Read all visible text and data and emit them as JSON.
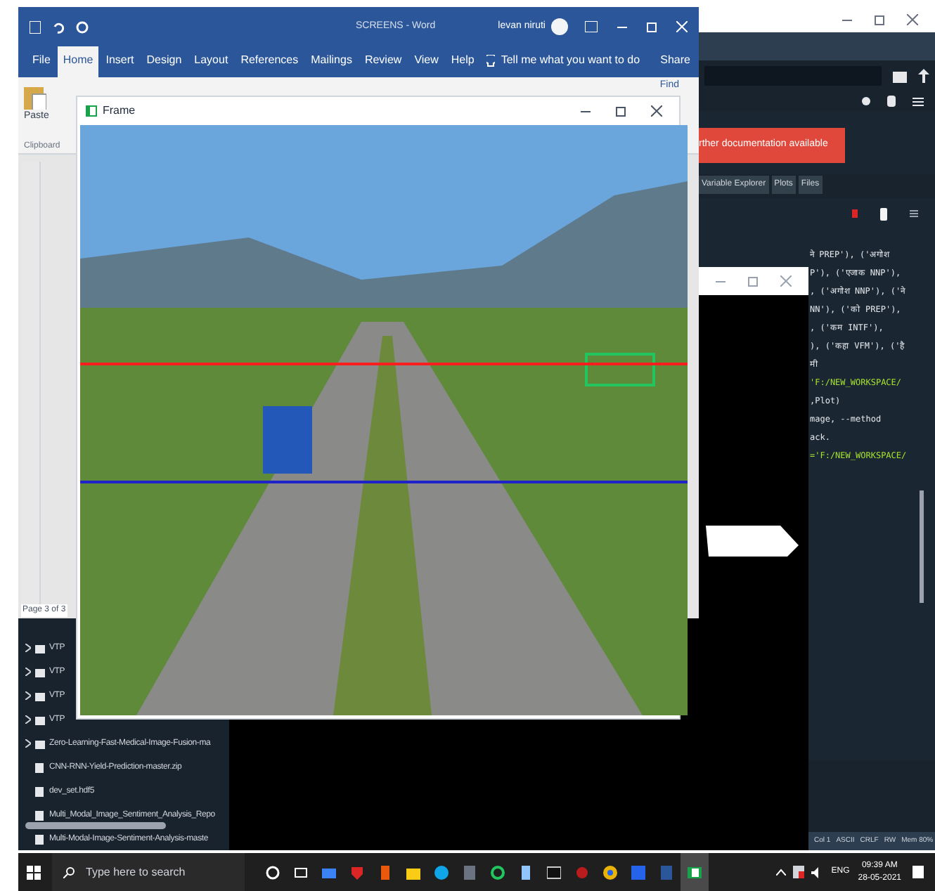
{
  "word": {
    "title": "SCREENS - Word",
    "user": "levan niruti",
    "tabs": [
      {
        "label": "File",
        "selected": false
      },
      {
        "label": "Home",
        "selected": true
      },
      {
        "label": "Insert",
        "selected": false
      },
      {
        "label": "Design",
        "selected": false
      },
      {
        "label": "Layout",
        "selected": false
      },
      {
        "label": "References",
        "selected": false
      },
      {
        "label": "Mailings",
        "selected": false
      },
      {
        "label": "Review",
        "selected": false
      },
      {
        "label": "View",
        "selected": false
      },
      {
        "label": "Help",
        "selected": false
      }
    ],
    "tell_me": "Tell me what you want to do",
    "share": "Share",
    "paste": "Paste",
    "clipboard": "Clipboard",
    "find": "Find",
    "page_status": "Page 3 of 3"
  },
  "frame": {
    "title": "Frame"
  },
  "spyder": {
    "banner": "rther documentation available",
    "panes": [
      "Variable Explorer",
      "Plots",
      "Files"
    ],
    "code": [
      "ने PREP'), ('अगोश",
      "P'), ('एजाक NNP'),",
      ", ('अगोश NNP'), ('ने",
      "NN'), ('को PREP'),",
      ", ('कम INTF'),",
      "), ('कहा VFM'), ('है",
      "मी",
      "'F:/NEW_WORKSPACE/",
      ",Plot)",
      "mage, --method",
      "ack.",
      "='F:/NEW_WORKSPACE/"
    ],
    "status": [
      "Col 1",
      "ASCII",
      "CRLF",
      "RW",
      "Mem 80%"
    ]
  },
  "files": [
    {
      "name": "VTP",
      "kind": "folder"
    },
    {
      "name": "VTP",
      "kind": "folder"
    },
    {
      "name": "VTP",
      "kind": "folder"
    },
    {
      "name": "VTP",
      "kind": "folder"
    },
    {
      "name": "Zero-Learning-Fast-Medical-Image-Fusion-ma",
      "kind": "folder"
    },
    {
      "name": "CNN-RNN-Yield-Prediction-master.zip",
      "kind": "file"
    },
    {
      "name": "dev_set.hdf5",
      "kind": "file"
    },
    {
      "name": "Multi_Modal_Image_Sentiment_Analysis_Repo",
      "kind": "file"
    },
    {
      "name": "Multi-Modal-Image-Sentiment-Analysis-maste",
      "kind": "file"
    }
  ],
  "taskbar": {
    "search_placeholder": "Type here to search",
    "apps": [
      {
        "selected": false
      },
      {
        "selected": false
      },
      {
        "selected": false
      },
      {
        "selected": false
      },
      {
        "selected": false
      },
      {
        "selected": false
      },
      {
        "selected": false
      },
      {
        "selected": false
      },
      {
        "selected": false
      },
      {
        "selected": false
      },
      {
        "selected": false
      },
      {
        "selected": false
      },
      {
        "selected": false
      },
      {
        "selected": false
      },
      {
        "selected": false
      },
      {
        "selected": true
      }
    ],
    "language": "ENG",
    "time": "09:39 AM",
    "date": "28-05-2021"
  }
}
